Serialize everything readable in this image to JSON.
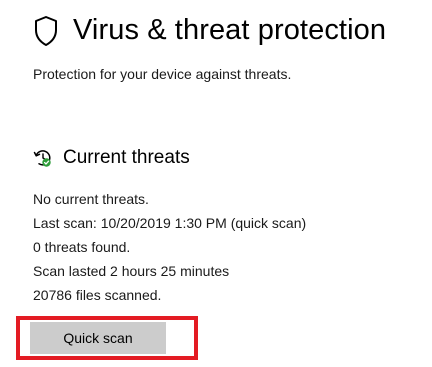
{
  "page": {
    "title": "Virus & threat protection",
    "subtitle": "Protection for your device against threats.",
    "icon": "shield-icon"
  },
  "current_threats": {
    "title": "Current threats",
    "icon": "threat-history-check-icon",
    "lines": [
      "No current threats.",
      "Last scan: 10/20/2019 1:30 PM (quick scan)",
      "0 threats found.",
      "Scan lasted 2 hours 25 minutes",
      "20786 files scanned."
    ],
    "quick_scan_label": "Quick scan"
  },
  "colors": {
    "highlight_border": "#e31b23",
    "button_background": "#cccccc",
    "status_green": "#2e9d3a"
  }
}
